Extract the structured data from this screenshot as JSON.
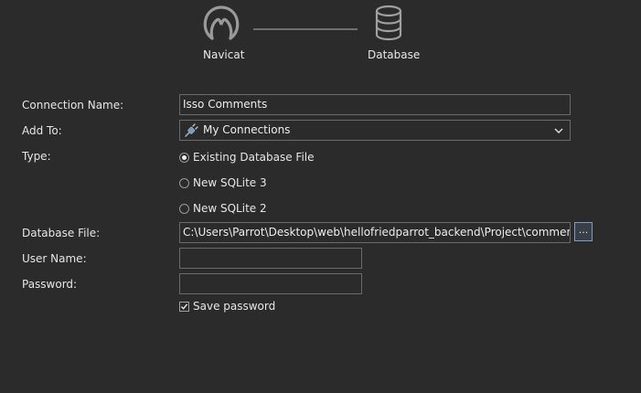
{
  "header": {
    "source_label": "Navicat",
    "target_label": "Database",
    "source_icon": "navicat-logo-icon",
    "target_icon": "database-icon"
  },
  "form": {
    "connection_name": {
      "label": "Connection Name:",
      "value": "Isso Comments"
    },
    "add_to": {
      "label": "Add To:",
      "value": "My Connections",
      "icon": "plug-icon"
    },
    "type": {
      "label": "Type:",
      "options": [
        {
          "label": "Existing Database File",
          "selected": true
        },
        {
          "label": "New SQLite 3",
          "selected": false
        },
        {
          "label": "New SQLite 2",
          "selected": false
        }
      ]
    },
    "database_file": {
      "label": "Database File:",
      "value": "C:\\Users\\Parrot\\Desktop\\web\\hellofriedparrot_backend\\Project\\comments\\con",
      "browse_label": "..."
    },
    "user_name": {
      "label": "User Name:",
      "value": ""
    },
    "password": {
      "label": "Password:",
      "value": ""
    },
    "save_password": {
      "label": "Save password",
      "checked": true
    }
  },
  "colors": {
    "background": "#2b2b2b",
    "text": "#e6e6e6",
    "field_border": "#6a6a6a",
    "connector_line": "#707070"
  }
}
